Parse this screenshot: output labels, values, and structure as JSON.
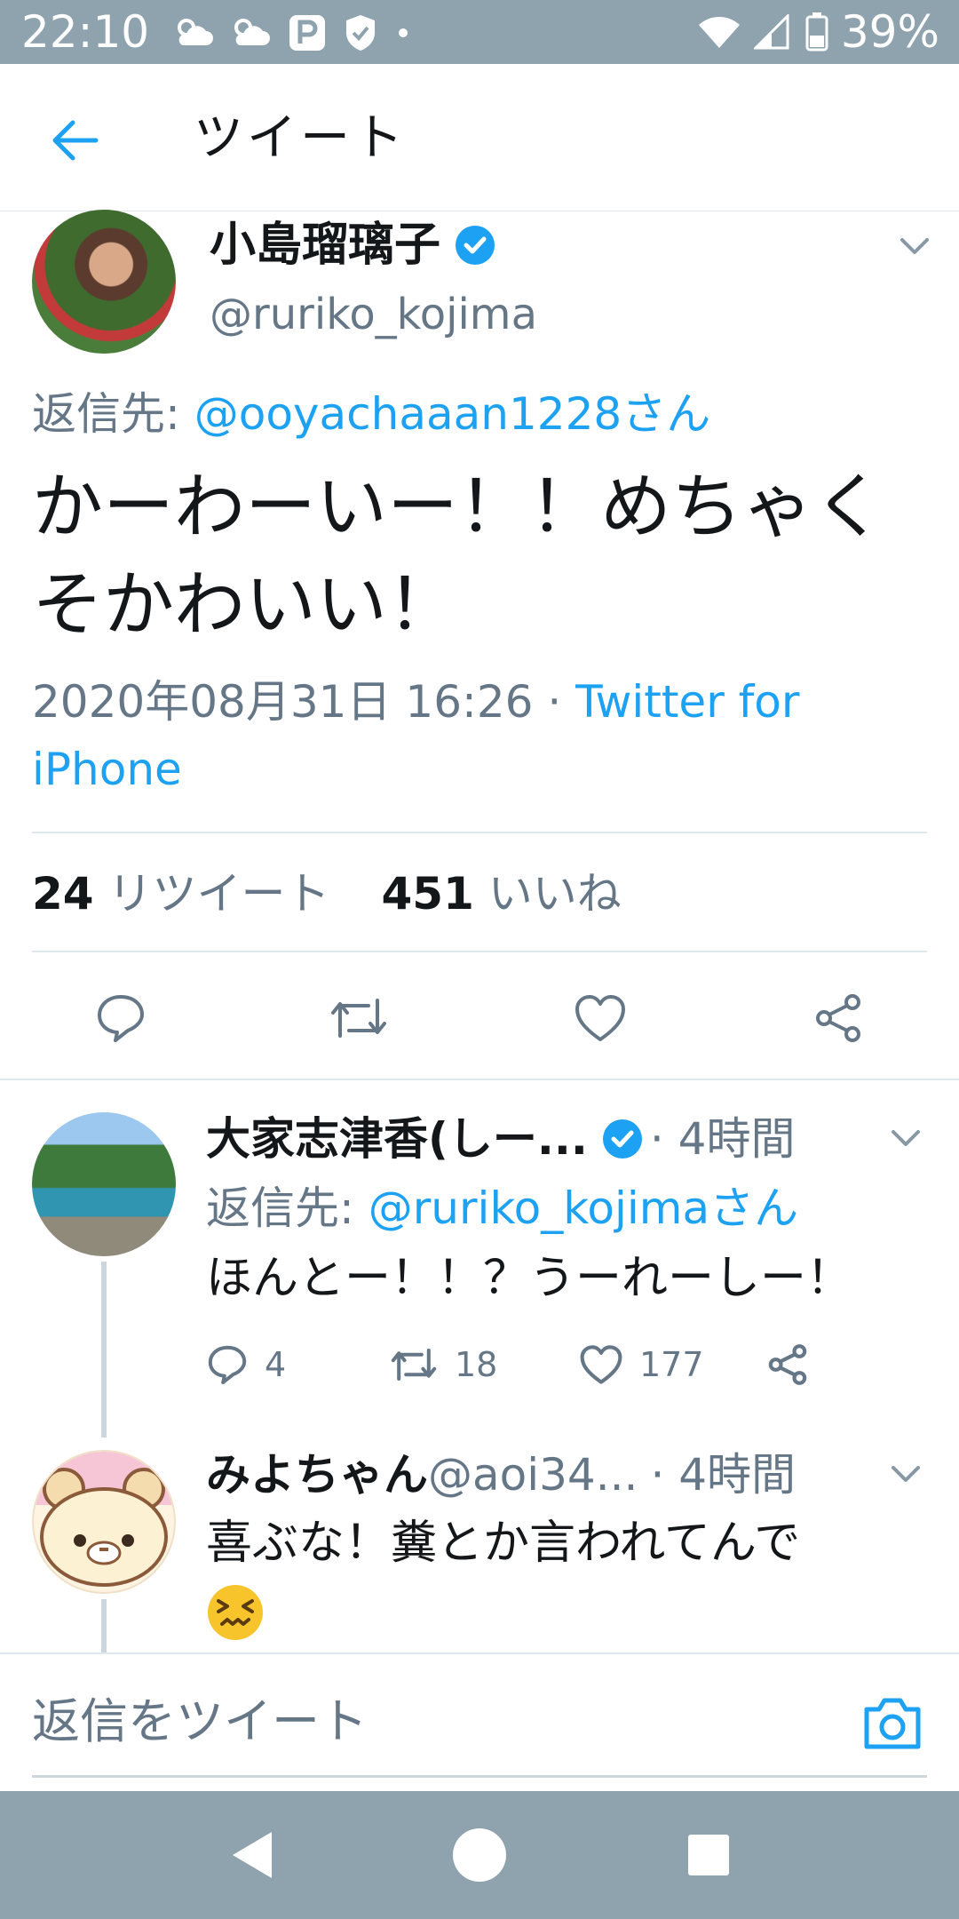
{
  "status_bar": {
    "time": "22:10",
    "battery": "39%"
  },
  "header": {
    "title": "ツイート"
  },
  "main_tweet": {
    "name": "小島瑠璃子",
    "handle": "@ruriko_kojima",
    "reply_prefix": "返信先: ",
    "reply_target": "@ooyachaaan1228さん",
    "text": "かーわーいー！！めちゃくそかわいい！",
    "timestamp": "2020年08月31日 16:26",
    "meta_sep": " · ",
    "client": "Twitter for iPhone",
    "retweets_count": "24",
    "retweets_label": "リツイート",
    "likes_count": "451",
    "likes_label": "いいね"
  },
  "replies": [
    {
      "name": "大家志津香(しー...",
      "time": " · 4時間",
      "reply_prefix": "返信先: ",
      "reply_target": "@ruriko_kojimaさん",
      "text": "ほんとー！！？うーれーしー！",
      "reply_count": "4",
      "retweet_count": "18",
      "like_count": "177"
    },
    {
      "name": "みよちゃん",
      "handle": " @aoi34...",
      "time": " · 4時間",
      "text": "喜ぶな！糞とか言われてんで"
    }
  ],
  "compose": {
    "placeholder": "返信をツイート"
  },
  "colors": {
    "accent": "#1da1f2",
    "verified": "#1da1f2",
    "muted": "#657786",
    "system_bar": "#8fa3ae"
  },
  "icons": [
    "back-arrow-icon",
    "verified-icon",
    "chevron-down-icon",
    "reply-icon",
    "retweet-icon",
    "like-icon",
    "share-icon",
    "camera-icon"
  ]
}
